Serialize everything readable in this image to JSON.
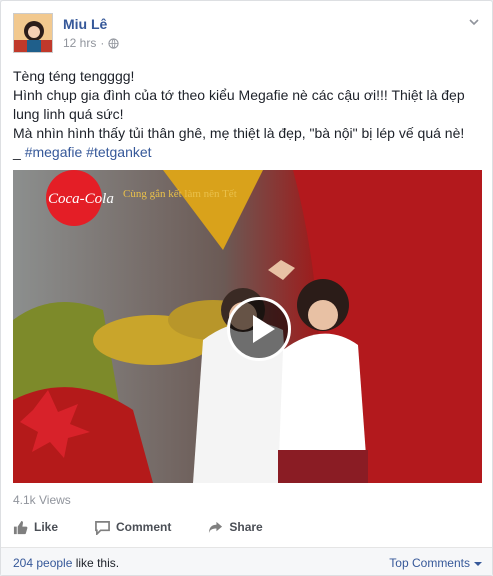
{
  "post": {
    "author": "Miu Lê",
    "time": "12 hrs",
    "separator": "·",
    "text_lines": [
      "Tèng téng tengggg!",
      "Hình chụp gia đình của tớ theo kiểu Megafie nè các cậu ơi!!! Thiệt là đẹp lung linh quá sức!",
      "Mà nhìn hình thấy tủi thân ghê, mẹ thiệt là đẹp, \"bà nội\" bị lép vế quá nè!"
    ],
    "hashtag_prefix": "_ ",
    "hashtags": "#megafie #tetganket",
    "video": {
      "overlay_text": "Coca-Cola",
      "banner_text": "Cùng gắn kết làm nên Tết"
    },
    "views": "4.1k Views"
  },
  "actions": {
    "like": "Like",
    "comment": "Comment",
    "share": "Share"
  },
  "footer": {
    "likes_count": "204 people",
    "likes_suffix": " like this.",
    "top_comments": "Top Comments"
  },
  "colors": {
    "link": "#365899",
    "muted": "#90949c",
    "coke_red": "#e41e26"
  },
  "icons": [
    "globe-icon",
    "chevron-down-icon",
    "play-icon",
    "like-icon",
    "comment-icon",
    "share-icon",
    "dropdown-triangle-icon"
  ]
}
